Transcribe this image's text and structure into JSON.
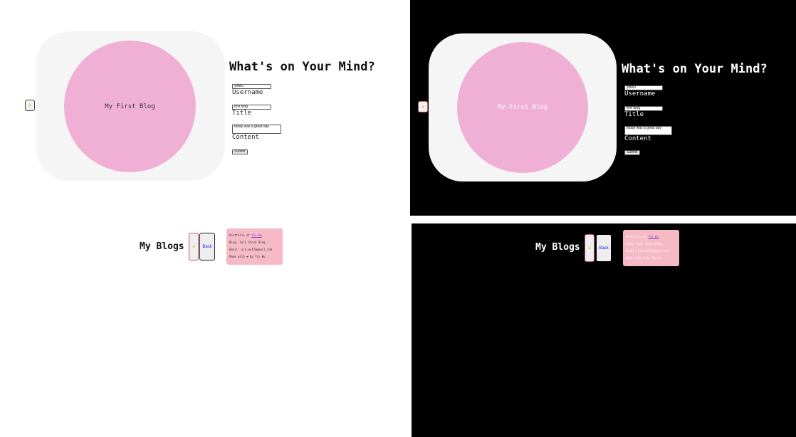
{
  "compose": {
    "heading": "What's on Your Mind?",
    "theme_toggle_icon": "sun-icon",
    "blog_circle_title": "My First Blog",
    "username_value": "yihwu",
    "username_label": "Username",
    "title_value": "first blog",
    "title_label": "Title",
    "content_value": "today was a great day",
    "content_label": "Content",
    "submit_label": "Submit"
  },
  "blogs": {
    "title": "My Blogs",
    "toggle_icon": "sun-icon",
    "back_label": "Back"
  },
  "footer": {
    "portfolio_prefix": "Portfolio of",
    "portfolio_link": "Yin Wu",
    "line2": "Blog: Full Stack Blog",
    "line3": "Email: yin.wu17@gmail.com",
    "line4": "Made with ❤ by Yin Wu"
  },
  "colors": {
    "circle": "#f0afd5",
    "card": "#f5f5f5",
    "footer_card": "#f6b9c6",
    "back_text": "#1a1aff"
  }
}
